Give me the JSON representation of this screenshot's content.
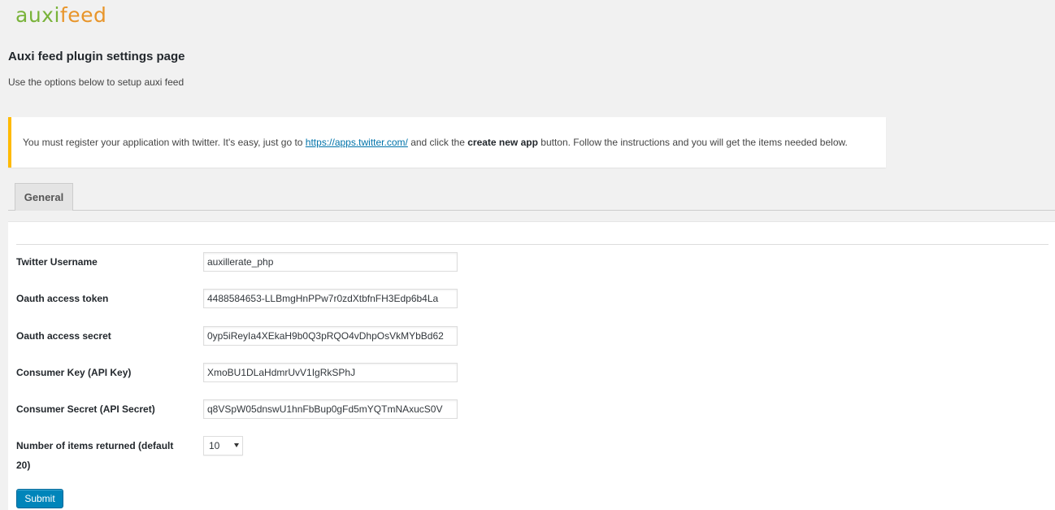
{
  "brand": {
    "logo_part1": "auxi",
    "logo_part2": "feed",
    "color_primary": "#79b33a",
    "color_secondary": "#e8952a"
  },
  "header": {
    "title": "Auxi feed plugin settings page",
    "subtitle": "Use the options below to setup auxi feed"
  },
  "notice": {
    "text_before": "You must register your application with twitter. It's easy, just go to ",
    "link_text": "https://apps.twitter.com/",
    "text_middle": " and click the ",
    "bold_text": "create new app",
    "text_after": " button. Follow the instructions and you will get the items needed below.",
    "accent_color": "#ffba00"
  },
  "tabs": [
    {
      "label": "General"
    }
  ],
  "form": {
    "fields": [
      {
        "label": "Twitter Username",
        "value": "auxillerate_php"
      },
      {
        "label": "Oauth access token",
        "value": "4488584653-LLBmgHnPPw7r0zdXtbfnFH3Edp6b4La"
      },
      {
        "label": "Oauth access secret",
        "value": "0yp5iReyIa4XEkaH9b0Q3pRQO4vDhpOsVkMYbBd62"
      },
      {
        "label": "Consumer Key (API Key)",
        "value": "XmoBU1DLaHdmrUvV1IgRkSPhJ"
      },
      {
        "label": "Consumer Secret (API Secret)",
        "value": "q8VSpW05dnswU1hnFbBup0gFd5mYQTmNAxucS0V"
      }
    ],
    "items_label_line1": "Number of items returned (default",
    "items_label_line2": "20)",
    "items_selected": "10",
    "submit_label": "Submit",
    "submit_color": "#0085ba"
  }
}
